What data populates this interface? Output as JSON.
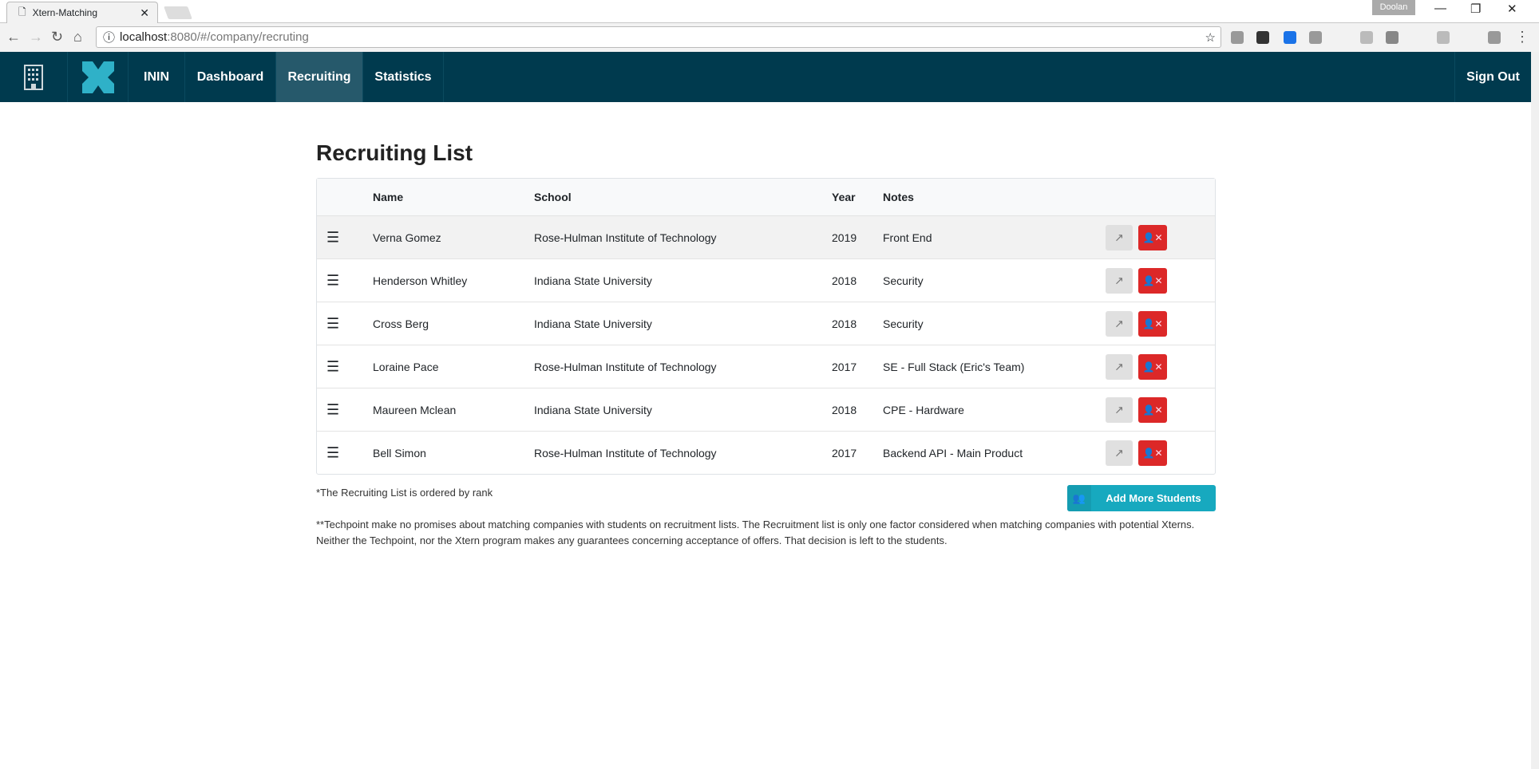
{
  "browser": {
    "tab_title": "Xtern-Matching",
    "profile": "Doolan",
    "url_host": "localhost",
    "url_rest": ":8080/#/company/recruting"
  },
  "nav": {
    "items": [
      "ININ",
      "Dashboard",
      "Recruiting",
      "Statistics"
    ],
    "active": "Recruiting",
    "sign_out": "Sign Out"
  },
  "page": {
    "title": "Recruiting List"
  },
  "table": {
    "headers": {
      "name": "Name",
      "school": "School",
      "year": "Year",
      "notes": "Notes"
    },
    "rows": [
      {
        "name": "Verna Gomez",
        "school": "Rose-Hulman Institute of Technology",
        "year": "2019",
        "notes": "Front End"
      },
      {
        "name": "Henderson Whitley",
        "school": "Indiana State University",
        "year": "2018",
        "notes": "Security"
      },
      {
        "name": "Cross Berg",
        "school": "Indiana State University",
        "year": "2018",
        "notes": "Security"
      },
      {
        "name": "Loraine Pace",
        "school": "Rose-Hulman Institute of Technology",
        "year": "2017",
        "notes": "SE - Full Stack (Eric's Team)"
      },
      {
        "name": "Maureen Mclean",
        "school": "Indiana State University",
        "year": "2018",
        "notes": "CPE - Hardware"
      },
      {
        "name": "Bell Simon",
        "school": "Rose-Hulman Institute of Technology",
        "year": "2017",
        "notes": "Backend API - Main Product"
      }
    ]
  },
  "footer": {
    "note1": "*The Recruiting List is ordered by rank",
    "add_button": "Add More Students",
    "note2": "**Techpoint make no promises about matching companies with students on recruitment lists. The Recruitment list is only one factor considered when matching companies with potential Xterns. Neither the Techpoint, nor the Xtern program makes any guarantees concerning acceptance of offers. That decision is left to the students."
  },
  "colors": {
    "nav": "#003a4e",
    "active": "#26596b",
    "danger": "#dc2828",
    "accent": "#17a9bf"
  }
}
